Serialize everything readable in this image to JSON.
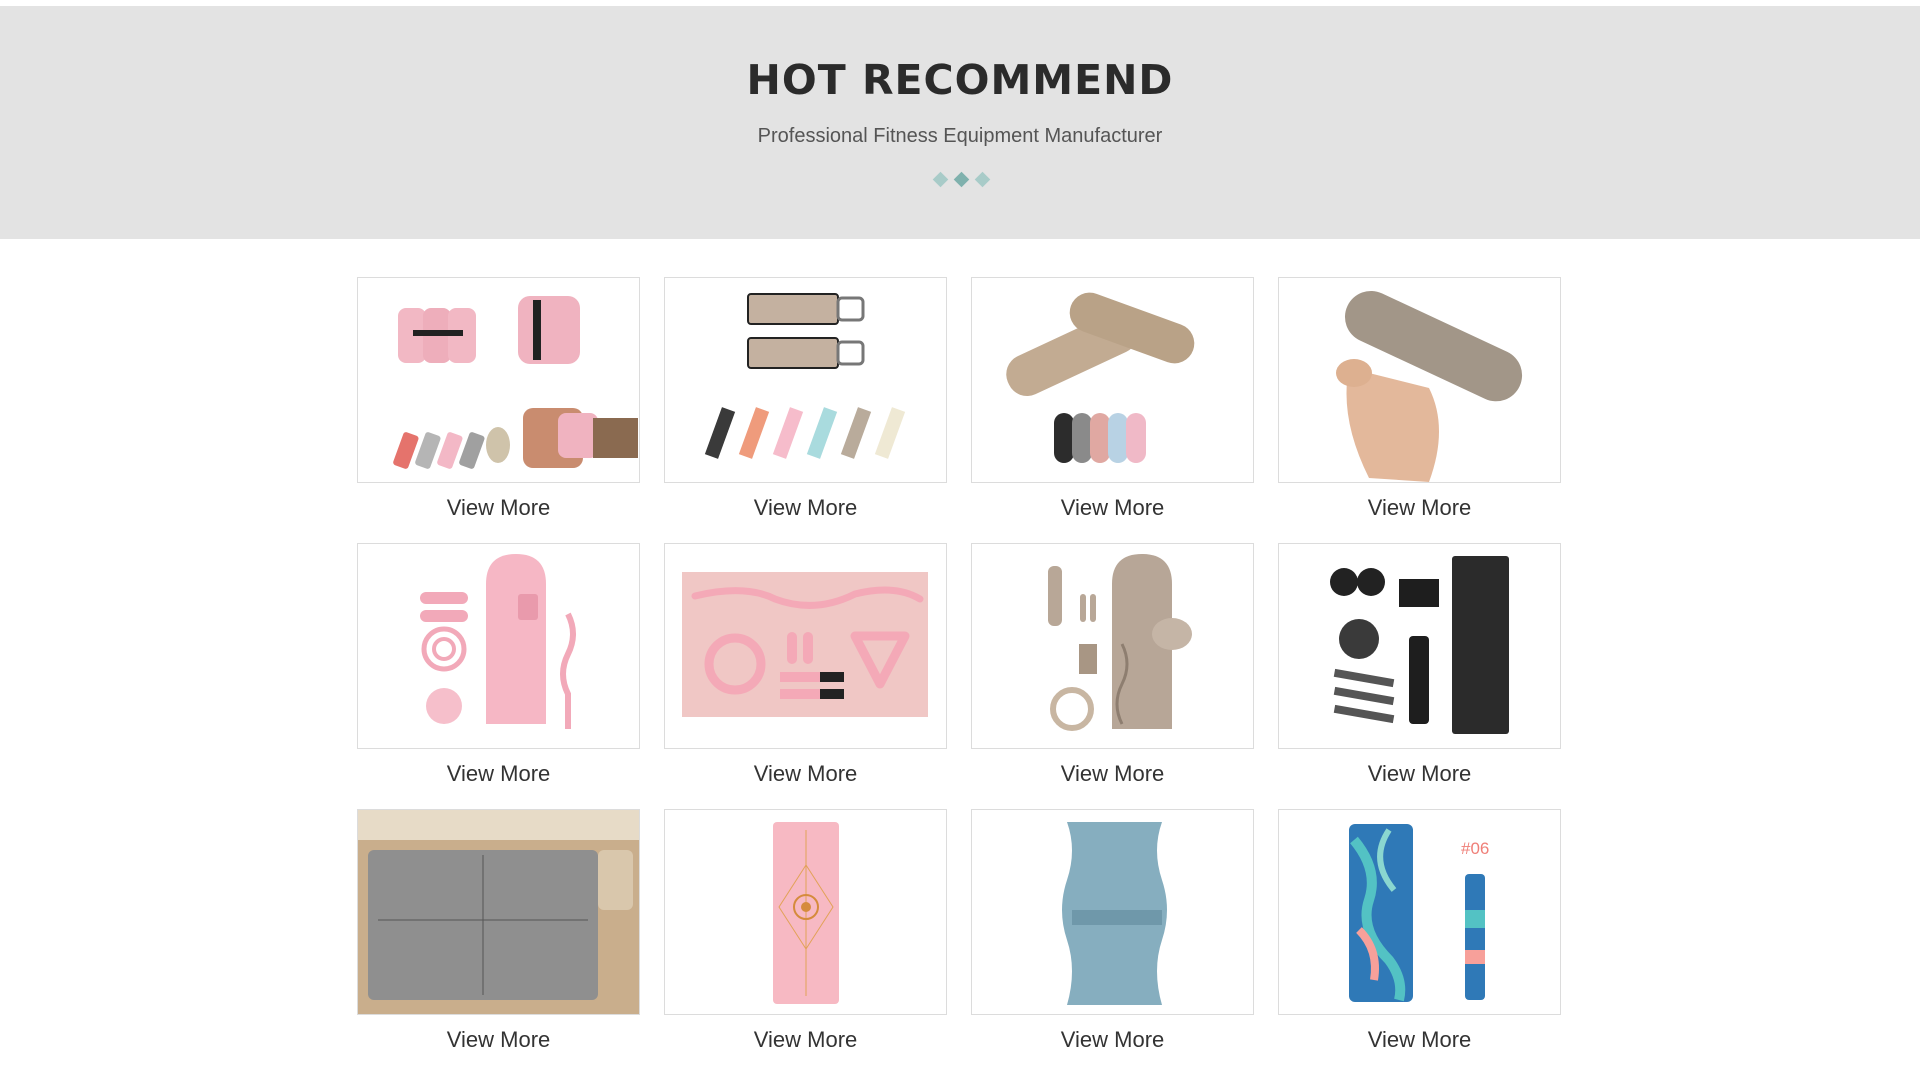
{
  "header": {
    "title": "HOT RECOMMEND",
    "subtitle": "Professional Fitness Equipment Manufacturer",
    "accent_colors": [
      "#a8cbc8",
      "#7fb1ad",
      "#a8cbc8"
    ]
  },
  "products": [
    {
      "image": "pink-wrist-weights",
      "link_label": "View More"
    },
    {
      "image": "ankle-weight-straps",
      "link_label": "View More"
    },
    {
      "image": "silicone-dumbbell-bars",
      "link_label": "View More"
    },
    {
      "image": "hand-held-weight",
      "link_label": "View More"
    },
    {
      "image": "pink-pilates-set",
      "link_label": "View More"
    },
    {
      "image": "pink-accessory-flatlay",
      "link_label": "View More"
    },
    {
      "image": "taupe-pilates-set",
      "link_label": "View More"
    },
    {
      "image": "black-fitness-set",
      "link_label": "View More"
    },
    {
      "image": "reformer-mat",
      "link_label": "View More"
    },
    {
      "image": "pink-yoga-mat",
      "link_label": "View More"
    },
    {
      "image": "blue-yoga-mat",
      "link_label": "View More"
    },
    {
      "image": "marble-yoga-mat",
      "link_label": "View More",
      "tag": "#06"
    }
  ]
}
